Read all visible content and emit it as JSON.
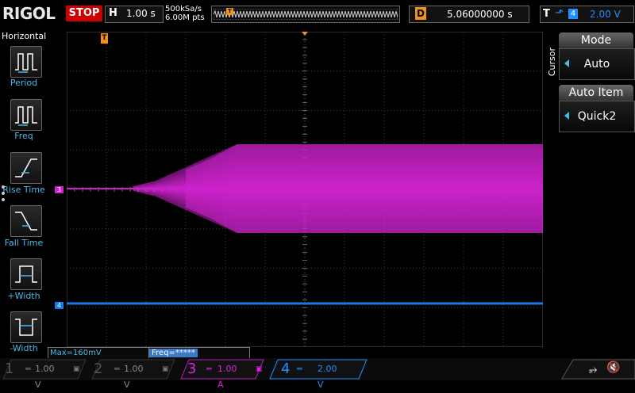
{
  "header": {
    "logo": "RIGOL",
    "run_status": "STOP",
    "timebase_label": "H",
    "timebase_value": "1.00 s",
    "sample_rate": "500kSa/s",
    "memory_depth": "6.00M pts",
    "delay_label": "D",
    "delay_value": "5.06000000 s",
    "trigger_label": "T",
    "trigger_source": "4",
    "trigger_level": "2.00 V"
  },
  "left_menu": {
    "title": "Horizontal",
    "items": [
      {
        "label": "Period",
        "icon": "period-icon"
      },
      {
        "label": "Freq",
        "icon": "frequency-icon"
      },
      {
        "label": "Rise Time",
        "icon": "rise-time-icon"
      },
      {
        "label": "Fall Time",
        "icon": "fall-time-icon"
      },
      {
        "label": "+Width",
        "icon": "positive-width-icon"
      },
      {
        "label": "-Width",
        "icon": "negative-width-icon"
      }
    ]
  },
  "right_menu": {
    "tab": "Cursor",
    "mode_label": "Mode",
    "mode_value": "Auto",
    "auto_item_label": "Auto Item",
    "auto_item_value": "Quick2"
  },
  "screen": {
    "ch3_marker": "3",
    "ch4_marker": "4",
    "trigger_marker": "T",
    "top_marker": "T"
  },
  "measurements": {
    "max": "Max=160mV",
    "freq": "Freq=*****"
  },
  "channels": [
    {
      "number": "1",
      "scale": "1.00 V",
      "color": "#f0e000",
      "active": false
    },
    {
      "number": "2",
      "scale": "1.00 V",
      "color": "#00e0e0",
      "active": false
    },
    {
      "number": "3",
      "scale": "1.00 A",
      "color": "#e020e0",
      "active": true
    },
    {
      "number": "4",
      "scale": "2.00 V",
      "color": "#1e90ff",
      "active": true
    }
  ],
  "colors": {
    "ch3": "#cc22cc",
    "ch4": "#1e78e8",
    "accent": "#f39018",
    "menu_text": "#4ab8e8"
  }
}
